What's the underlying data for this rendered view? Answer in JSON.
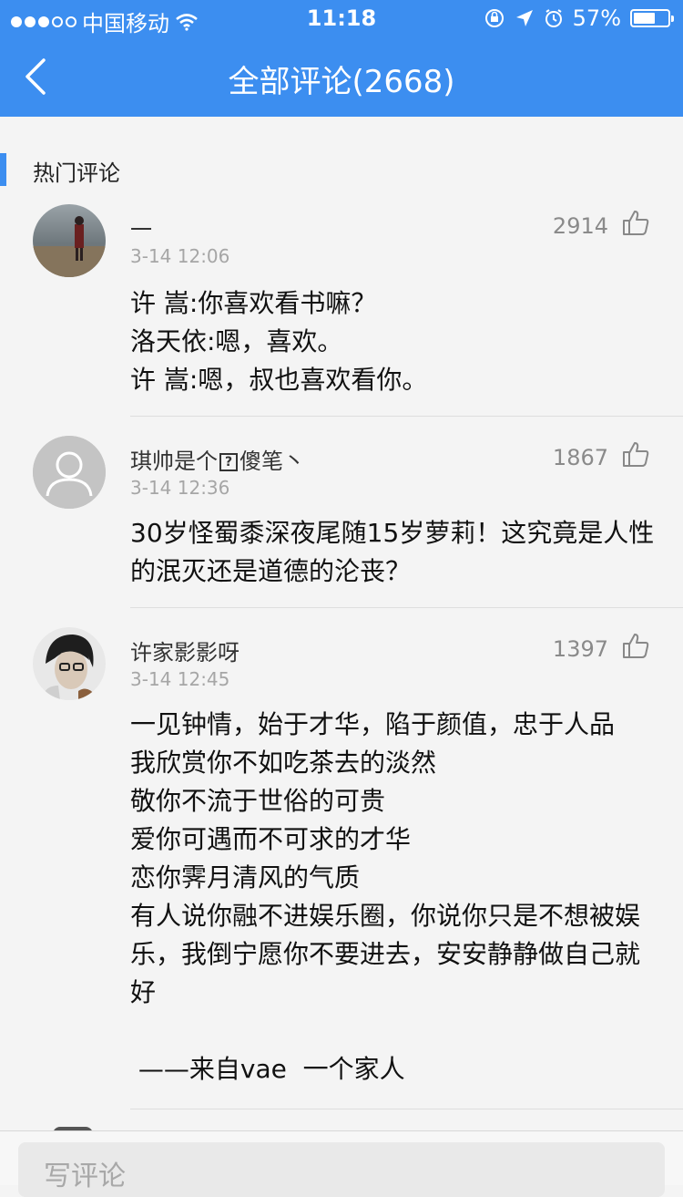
{
  "status_bar": {
    "carrier": "中国移动",
    "time": "11:18",
    "battery": "57%",
    "battery_level": 0.57
  },
  "nav": {
    "title": "全部评论(2668)",
    "back_icon": "chevron-left-icon"
  },
  "section": {
    "label": "热门评论"
  },
  "comments": [
    {
      "username": "一",
      "date": "3-14 12:06",
      "likes": "2914",
      "lines": [
        "许  嵩:你喜欢看书嘛？",
        "洛天依:嗯，喜欢。",
        "许  嵩:嗯，叔也喜欢看你。"
      ]
    },
    {
      "username_before": "琪帅是个",
      "username_box": "?",
      "username_after": "傻笔丶",
      "date": "3-14 12:36",
      "likes": "1867",
      "lines": [
        "30岁怪蜀黍深夜尾随15岁萝莉！这究竟是人性",
        "的泯灭还是道德的沦丧？"
      ]
    },
    {
      "username": "许家影影呀",
      "date": "3-14 12:45",
      "likes": "1397",
      "lines": [
        "一见钟情，始于才华，陷于颜值，忠于人品",
        "我欣赏你不如吃茶去的淡然",
        "敬你不流于世俗的可贵",
        "爱你可遇而不可求的才华",
        "恋你霁月清风的气质",
        "有人说你融不进娱乐圈，你说你只是不想被娱",
        "乐，我倒宁愿你不要进去，安安静静做自己就",
        "好",
        "",
        " ——来自vae  一个家人"
      ]
    }
  ],
  "input": {
    "placeholder": "写评论"
  },
  "colors": {
    "accent": "#3c8ef0",
    "background": "#f4f4f4",
    "meta_text": "#a6a6a6"
  }
}
